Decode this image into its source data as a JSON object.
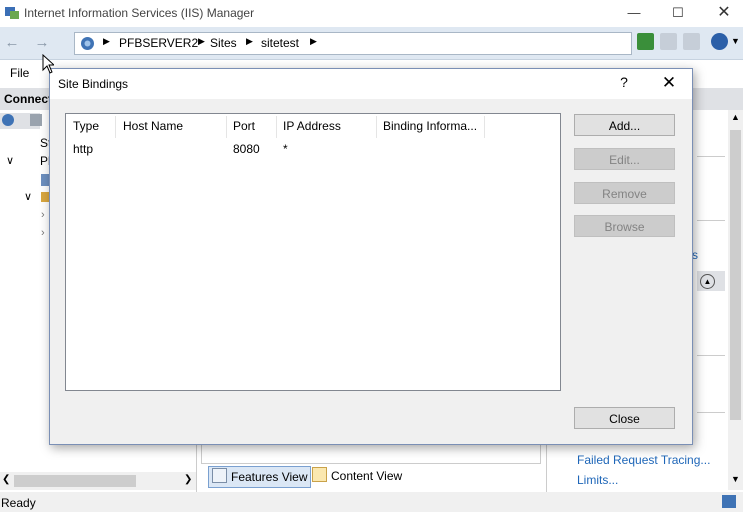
{
  "window": {
    "title": "Internet Information Services (IIS) Manager"
  },
  "address": {
    "crumbs": [
      "PFBSERVER2",
      "Sites",
      "sitetest"
    ]
  },
  "menu": {
    "file": "File"
  },
  "connections": {
    "header": "Connect",
    "tree_partial": [
      "St",
      "Pl"
    ]
  },
  "actions": {
    "links": [
      "Failed Request Tracing...",
      "Limits..."
    ],
    "partial_link": "s"
  },
  "views": {
    "features": "Features View",
    "content": "Content View"
  },
  "status": {
    "text": "Ready"
  },
  "dialog": {
    "title": "Site Bindings",
    "help": "?",
    "close_glyph": "✕",
    "columns": [
      "Type",
      "Host Name",
      "Port",
      "IP Address",
      "Binding Informa..."
    ],
    "rows": [
      {
        "type": "http",
        "host": "",
        "port": "8080",
        "ip": "*",
        "info": ""
      }
    ],
    "buttons": {
      "add": "Add...",
      "edit": "Edit...",
      "remove": "Remove",
      "browse": "Browse",
      "close": "Close"
    }
  },
  "colors": {
    "accent_link": "#1e66b8",
    "nav_bg": "#dfe8f2"
  }
}
